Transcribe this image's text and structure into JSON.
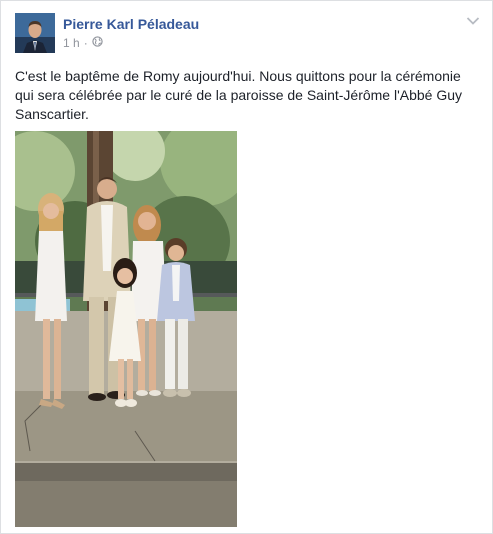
{
  "post": {
    "author": "Pierre Karl Péladeau",
    "timestamp": "1 h",
    "separator": "·",
    "audience_icon": "globe-icon",
    "menu_icon": "chevron-down-icon",
    "text": "C'est le baptême de Romy aujourd'hui. Nous quittons pour la cérémonie qui sera célébrée par le curé de la paroisse de Saint-Jérôme l'Abbé Guy Sanscartier."
  },
  "colors": {
    "author_link": "#365899",
    "meta_gray": "#90949c",
    "text": "#1d2129",
    "border": "#dddfe2"
  }
}
